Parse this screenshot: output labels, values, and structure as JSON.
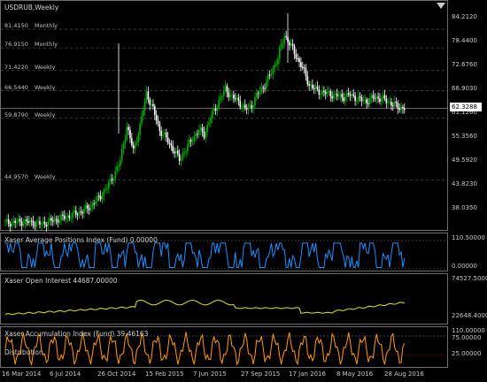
{
  "symbol": "USDRUB,Weekly",
  "current_price": "62.3288",
  "colors": {
    "bull": "#00b000",
    "bear": "#ffffff",
    "api": "#1e90ff",
    "oi": "#e6e600",
    "aci": "#ff9c00",
    "level_line": "#b0b0b0",
    "red_level": "#c00000"
  },
  "levels": [
    {
      "price": "81.4150",
      "label": "Monthly"
    },
    {
      "price": "76.9150",
      "label": "Monthly"
    },
    {
      "price": "71.4220",
      "label": "Weekly"
    },
    {
      "price": "66.5440",
      "label": "Weekly"
    },
    {
      "price": "59.8790",
      "label": "Weekly"
    },
    {
      "price": "44.9570",
      "label": "Weekly"
    }
  ],
  "price_axis": [
    "84.2120",
    "78.4400",
    "72.6760",
    "66.9030",
    "61.1260",
    "55.3560",
    "49.5920",
    "43.8230",
    "38.0350"
  ],
  "indicators": {
    "api": {
      "title": "Xaser Average Positions Index (Fund) 0.00000",
      "axis_top": "110.50000",
      "axis_bottom": "0.00000"
    },
    "oi": {
      "title": "Xaser Open Interest 44687.00000",
      "axis_top": "74527.50000",
      "axis_bottom": "22648.40000"
    },
    "aci": {
      "title": "Xaser Accumulation Index (Fund) 39.46163",
      "axis_top": "110.00000",
      "axis_mid": "75.00000",
      "axis_low": "25.00000",
      "sub_label": "Distribution"
    }
  },
  "time_axis": [
    "16 Mar 2014",
    "6 Jul 2014",
    "26 Oct 2014",
    "15 Feb 2015",
    "7 Jun 2015",
    "27 Sep 2015",
    "17 Jan 2016",
    "8 May 2016",
    "28 Aug 2016"
  ]
}
